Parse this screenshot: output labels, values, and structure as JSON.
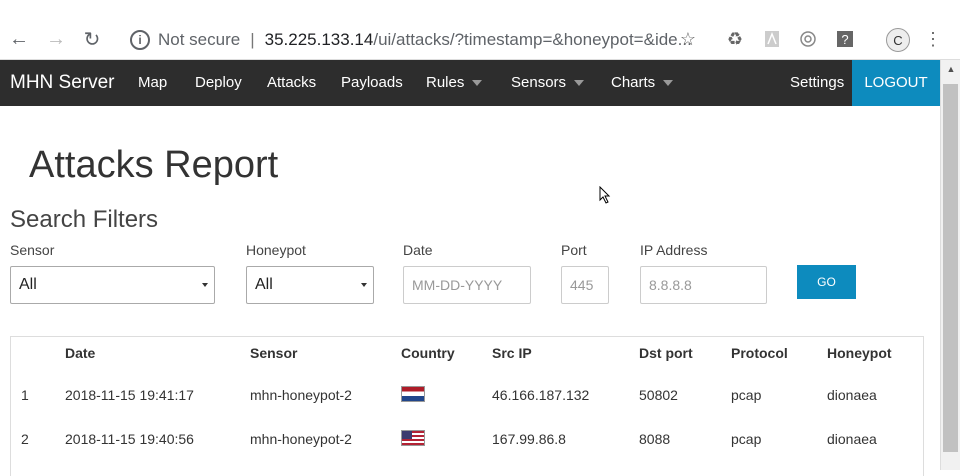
{
  "browser": {
    "not_secure": "Not secure",
    "url_host": "35.225.133.14",
    "url_path": "/ui/attacks/?timestamp=&honeypot=&ide...",
    "avatar_letter": "C"
  },
  "navbar": {
    "brand": "MHN Server",
    "links": [
      "Map",
      "Deploy",
      "Attacks",
      "Payloads",
      "Rules",
      "Sensors",
      "Charts"
    ],
    "settings": "Settings",
    "logout": "LOGOUT"
  },
  "page": {
    "title": "Attacks Report",
    "filters_heading": "Search Filters"
  },
  "filters": {
    "sensor_label": "Sensor",
    "sensor_value": "All",
    "honeypot_label": "Honeypot",
    "honeypot_value": "All",
    "date_label": "Date",
    "date_placeholder": "MM-DD-YYYY",
    "port_label": "Port",
    "port_placeholder": "445",
    "ip_label": "IP Address",
    "ip_placeholder": "8.8.8.8",
    "go": "GO"
  },
  "table": {
    "headers": [
      "",
      "Date",
      "Sensor",
      "Country",
      "Src IP",
      "Dst port",
      "Protocol",
      "Honeypot"
    ],
    "rows": [
      {
        "num": "1",
        "date": "2018-11-15 19:41:17",
        "sensor": "mhn-honeypot-2",
        "country_flag": "netherlands-flag-icon",
        "src_ip": "46.166.187.132",
        "dst_port": "50802",
        "protocol": "pcap",
        "honeypot": "dionaea"
      },
      {
        "num": "2",
        "date": "2018-11-15 19:40:56",
        "sensor": "mhn-honeypot-2",
        "country_flag": "united-states-flag-icon",
        "src_ip": "167.99.86.8",
        "dst_port": "8088",
        "protocol": "pcap",
        "honeypot": "dionaea"
      }
    ]
  },
  "colors": {
    "navbar_bg": "#2d2d2d",
    "accent": "#0d8bbe"
  }
}
